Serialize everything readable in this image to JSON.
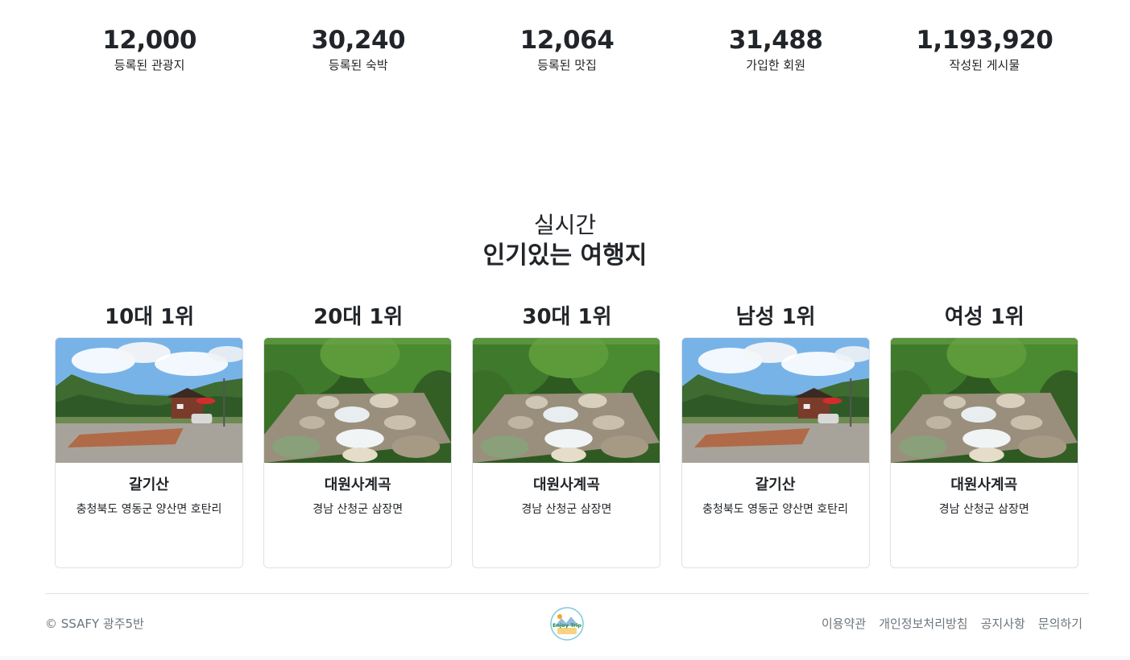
{
  "stats": [
    {
      "value": "12,000",
      "label": "등록된 관광지"
    },
    {
      "value": "30,240",
      "label": "등록된 숙박"
    },
    {
      "value": "12,064",
      "label": "등록된 맛집"
    },
    {
      "value": "31,488",
      "label": "가입한 회원"
    },
    {
      "value": "1,193,920",
      "label": "작성된 게시물"
    }
  ],
  "popular": {
    "title_line1": "실시간",
    "title_line2": "인기있는 여행지",
    "cards": [
      {
        "rank": "10대 1위",
        "name": "갈기산",
        "address": "충청북도 영동군 양산면 호탄리",
        "image": "campsite"
      },
      {
        "rank": "20대 1위",
        "name": "대원사계곡",
        "address": "경남 산청군 삼장면",
        "image": "valley"
      },
      {
        "rank": "30대 1위",
        "name": "대원사계곡",
        "address": "경남 산청군 삼장면",
        "image": "valley"
      },
      {
        "rank": "남성 1위",
        "name": "갈기산",
        "address": "충청북도 영동군 양산면 호탄리",
        "image": "campsite"
      },
      {
        "rank": "여성 1위",
        "name": "대원사계곡",
        "address": "경남 산청군 삼장면",
        "image": "valley"
      }
    ]
  },
  "footer": {
    "copyright": "© SSAFY 광주5반",
    "logo_text": "Enjoy Trip",
    "links": [
      "이용약관",
      "개인정보처리방침",
      "공지사항",
      "문의하기"
    ]
  }
}
